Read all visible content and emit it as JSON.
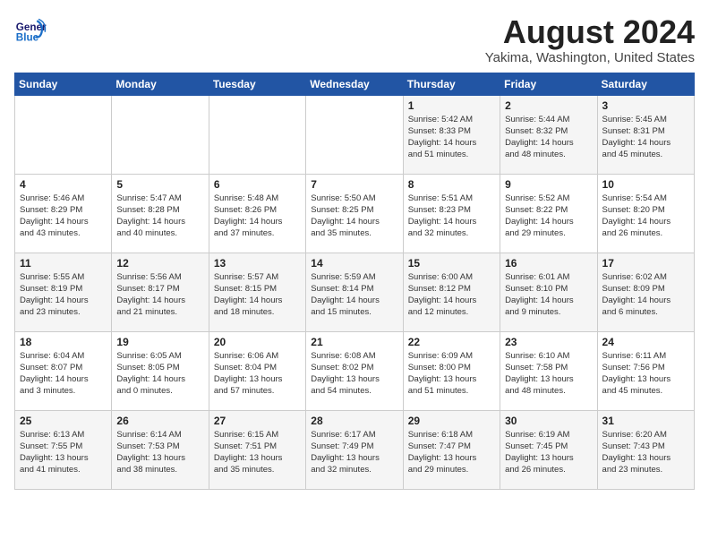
{
  "header": {
    "logo_line1": "General",
    "logo_line2": "Blue",
    "title": "August 2024",
    "subtitle": "Yakima, Washington, United States"
  },
  "weekdays": [
    "Sunday",
    "Monday",
    "Tuesday",
    "Wednesday",
    "Thursday",
    "Friday",
    "Saturday"
  ],
  "weeks": [
    [
      {
        "day": "",
        "info": ""
      },
      {
        "day": "",
        "info": ""
      },
      {
        "day": "",
        "info": ""
      },
      {
        "day": "",
        "info": ""
      },
      {
        "day": "1",
        "info": "Sunrise: 5:42 AM\nSunset: 8:33 PM\nDaylight: 14 hours\nand 51 minutes."
      },
      {
        "day": "2",
        "info": "Sunrise: 5:44 AM\nSunset: 8:32 PM\nDaylight: 14 hours\nand 48 minutes."
      },
      {
        "day": "3",
        "info": "Sunrise: 5:45 AM\nSunset: 8:31 PM\nDaylight: 14 hours\nand 45 minutes."
      }
    ],
    [
      {
        "day": "4",
        "info": "Sunrise: 5:46 AM\nSunset: 8:29 PM\nDaylight: 14 hours\nand 43 minutes."
      },
      {
        "day": "5",
        "info": "Sunrise: 5:47 AM\nSunset: 8:28 PM\nDaylight: 14 hours\nand 40 minutes."
      },
      {
        "day": "6",
        "info": "Sunrise: 5:48 AM\nSunset: 8:26 PM\nDaylight: 14 hours\nand 37 minutes."
      },
      {
        "day": "7",
        "info": "Sunrise: 5:50 AM\nSunset: 8:25 PM\nDaylight: 14 hours\nand 35 minutes."
      },
      {
        "day": "8",
        "info": "Sunrise: 5:51 AM\nSunset: 8:23 PM\nDaylight: 14 hours\nand 32 minutes."
      },
      {
        "day": "9",
        "info": "Sunrise: 5:52 AM\nSunset: 8:22 PM\nDaylight: 14 hours\nand 29 minutes."
      },
      {
        "day": "10",
        "info": "Sunrise: 5:54 AM\nSunset: 8:20 PM\nDaylight: 14 hours\nand 26 minutes."
      }
    ],
    [
      {
        "day": "11",
        "info": "Sunrise: 5:55 AM\nSunset: 8:19 PM\nDaylight: 14 hours\nand 23 minutes."
      },
      {
        "day": "12",
        "info": "Sunrise: 5:56 AM\nSunset: 8:17 PM\nDaylight: 14 hours\nand 21 minutes."
      },
      {
        "day": "13",
        "info": "Sunrise: 5:57 AM\nSunset: 8:15 PM\nDaylight: 14 hours\nand 18 minutes."
      },
      {
        "day": "14",
        "info": "Sunrise: 5:59 AM\nSunset: 8:14 PM\nDaylight: 14 hours\nand 15 minutes."
      },
      {
        "day": "15",
        "info": "Sunrise: 6:00 AM\nSunset: 8:12 PM\nDaylight: 14 hours\nand 12 minutes."
      },
      {
        "day": "16",
        "info": "Sunrise: 6:01 AM\nSunset: 8:10 PM\nDaylight: 14 hours\nand 9 minutes."
      },
      {
        "day": "17",
        "info": "Sunrise: 6:02 AM\nSunset: 8:09 PM\nDaylight: 14 hours\nand 6 minutes."
      }
    ],
    [
      {
        "day": "18",
        "info": "Sunrise: 6:04 AM\nSunset: 8:07 PM\nDaylight: 14 hours\nand 3 minutes."
      },
      {
        "day": "19",
        "info": "Sunrise: 6:05 AM\nSunset: 8:05 PM\nDaylight: 14 hours\nand 0 minutes."
      },
      {
        "day": "20",
        "info": "Sunrise: 6:06 AM\nSunset: 8:04 PM\nDaylight: 13 hours\nand 57 minutes."
      },
      {
        "day": "21",
        "info": "Sunrise: 6:08 AM\nSunset: 8:02 PM\nDaylight: 13 hours\nand 54 minutes."
      },
      {
        "day": "22",
        "info": "Sunrise: 6:09 AM\nSunset: 8:00 PM\nDaylight: 13 hours\nand 51 minutes."
      },
      {
        "day": "23",
        "info": "Sunrise: 6:10 AM\nSunset: 7:58 PM\nDaylight: 13 hours\nand 48 minutes."
      },
      {
        "day": "24",
        "info": "Sunrise: 6:11 AM\nSunset: 7:56 PM\nDaylight: 13 hours\nand 45 minutes."
      }
    ],
    [
      {
        "day": "25",
        "info": "Sunrise: 6:13 AM\nSunset: 7:55 PM\nDaylight: 13 hours\nand 41 minutes."
      },
      {
        "day": "26",
        "info": "Sunrise: 6:14 AM\nSunset: 7:53 PM\nDaylight: 13 hours\nand 38 minutes."
      },
      {
        "day": "27",
        "info": "Sunrise: 6:15 AM\nSunset: 7:51 PM\nDaylight: 13 hours\nand 35 minutes."
      },
      {
        "day": "28",
        "info": "Sunrise: 6:17 AM\nSunset: 7:49 PM\nDaylight: 13 hours\nand 32 minutes."
      },
      {
        "day": "29",
        "info": "Sunrise: 6:18 AM\nSunset: 7:47 PM\nDaylight: 13 hours\nand 29 minutes."
      },
      {
        "day": "30",
        "info": "Sunrise: 6:19 AM\nSunset: 7:45 PM\nDaylight: 13 hours\nand 26 minutes."
      },
      {
        "day": "31",
        "info": "Sunrise: 6:20 AM\nSunset: 7:43 PM\nDaylight: 13 hours\nand 23 minutes."
      }
    ]
  ]
}
